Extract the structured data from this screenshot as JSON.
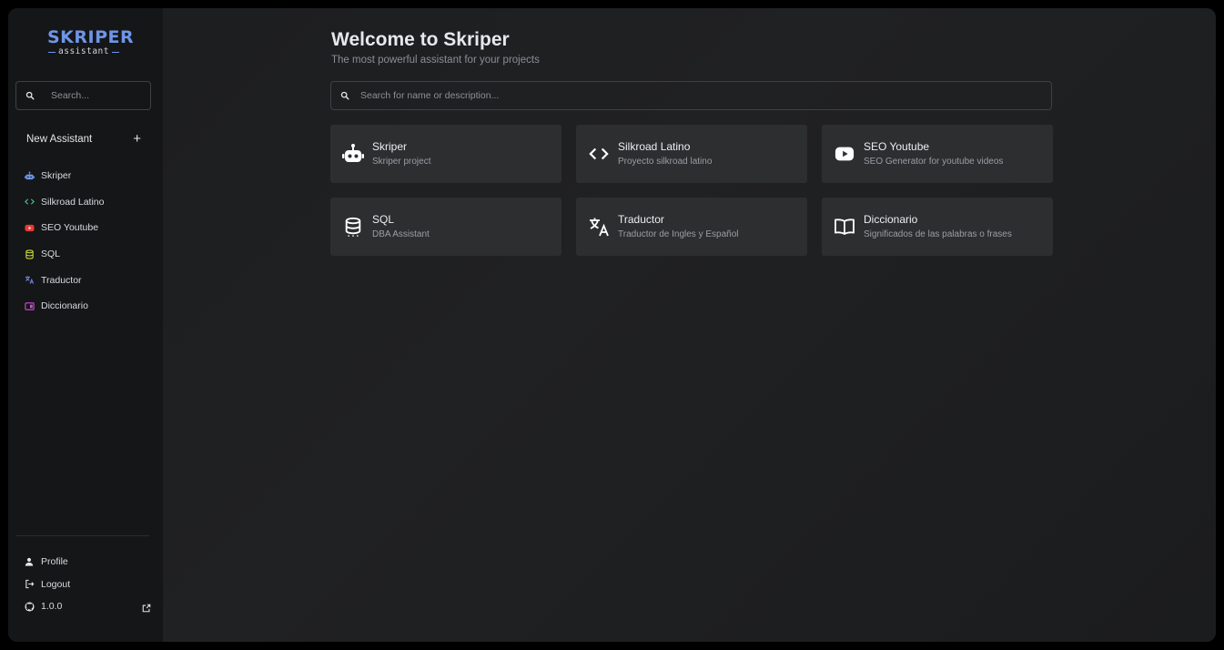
{
  "app": {
    "logo_main": "SKRIPER",
    "logo_sub": "assistant"
  },
  "sidebar": {
    "search_placeholder": "Search...",
    "new_assistant_label": "New Assistant",
    "items": [
      {
        "label": "Skriper",
        "icon": "robot-icon",
        "color": "#6f95e8"
      },
      {
        "label": "Silkroad Latino",
        "icon": "code-icon",
        "color": "#4cc38a"
      },
      {
        "label": "SEO Youtube",
        "icon": "youtube-icon",
        "color": "#e53935"
      },
      {
        "label": "SQL",
        "icon": "database-icon",
        "color": "#c6d23a"
      },
      {
        "label": "Traductor",
        "icon": "translate-icon",
        "color": "#7b8cf0"
      },
      {
        "label": "Diccionario",
        "icon": "book-icon",
        "color": "#d14fd6"
      }
    ],
    "bottom": {
      "profile_label": "Profile",
      "logout_label": "Logout",
      "version_label": "1.0.0"
    }
  },
  "main": {
    "title": "Welcome to Skriper",
    "subtitle": "The most powerful assistant for your projects",
    "search_placeholder": "Search for name or description...",
    "cards": [
      {
        "title": "Skriper",
        "description": "Skriper project",
        "icon": "robot-icon"
      },
      {
        "title": "Silkroad Latino",
        "description": "Proyecto silkroad latino",
        "icon": "code-icon"
      },
      {
        "title": "SEO Youtube",
        "description": "SEO Generator for youtube videos",
        "icon": "youtube-icon"
      },
      {
        "title": "SQL",
        "description": "DBA Assistant",
        "icon": "database-icon"
      },
      {
        "title": "Traductor",
        "description": "Traductor de Ingles y Español",
        "icon": "translate-icon"
      },
      {
        "title": "Diccionario",
        "description": "Significados de las palabras o frases",
        "icon": "book-icon"
      }
    ]
  }
}
